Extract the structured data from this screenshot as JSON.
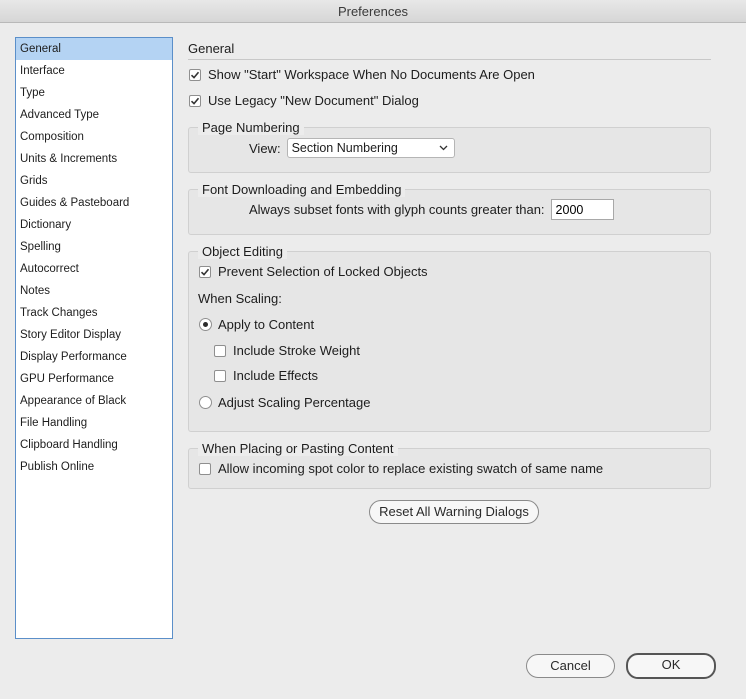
{
  "window": {
    "title": "Preferences"
  },
  "sidebar": {
    "items": [
      "General",
      "Interface",
      "Type",
      "Advanced Type",
      "Composition",
      "Units & Increments",
      "Grids",
      "Guides & Pasteboard",
      "Dictionary",
      "Spelling",
      "Autocorrect",
      "Notes",
      "Track Changes",
      "Story Editor Display",
      "Display Performance",
      "GPU Performance",
      "Appearance of Black",
      "File Handling",
      "Clipboard Handling",
      "Publish Online"
    ],
    "selected_index": 0
  },
  "main": {
    "title": "General",
    "show_start_workspace": {
      "label": "Show \"Start\" Workspace When No Documents Are Open",
      "checked": true
    },
    "use_legacy_dialog": {
      "label": "Use Legacy \"New Document\" Dialog",
      "checked": true
    },
    "page_numbering": {
      "title": "Page Numbering",
      "view_label": "View:",
      "view_value": "Section Numbering"
    },
    "font_downloading": {
      "title": "Font Downloading and Embedding",
      "subset_label": "Always subset fonts with glyph counts greater than:",
      "subset_value": "2000"
    },
    "object_editing": {
      "title": "Object Editing",
      "prevent_selection": {
        "label": "Prevent Selection of Locked Objects",
        "checked": true
      },
      "when_scaling_label": "When Scaling:",
      "apply_to_content": {
        "label": "Apply to Content",
        "selected": true
      },
      "include_stroke_weight": {
        "label": "Include Stroke Weight",
        "checked": false
      },
      "include_effects": {
        "label": "Include Effects",
        "checked": false
      },
      "adjust_scaling_percentage": {
        "label": "Adjust Scaling Percentage",
        "selected": false
      }
    },
    "placing_pasting": {
      "title": "When Placing or Pasting Content",
      "allow_spot_color": {
        "label": "Allow incoming spot color to replace existing swatch of same name",
        "checked": false
      }
    },
    "reset_warnings_label": "Reset All Warning Dialogs"
  },
  "footer": {
    "cancel_label": "Cancel",
    "ok_label": "OK"
  }
}
